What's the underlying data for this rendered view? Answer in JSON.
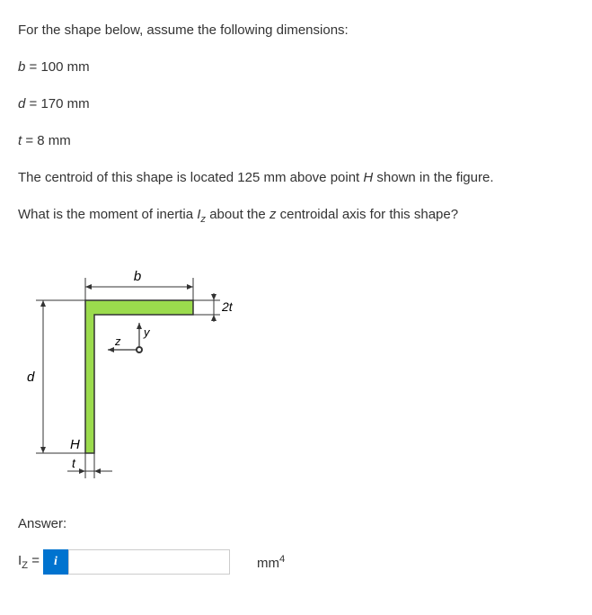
{
  "problem": {
    "intro": "For the shape below, assume the following dimensions:",
    "b_line": "b = 100 mm",
    "d_line": "d = 170 mm",
    "t_line": "t = 8 mm",
    "centroid_statement": "The centroid of this shape is located 125 mm above point H shown in the figure.",
    "question": "What is the moment of inertia Iz about the z centroidal axis for this shape?"
  },
  "figure": {
    "label_b": "b",
    "label_d": "d",
    "label_t": "t",
    "label_2t": "2t",
    "label_H": "H",
    "label_z": "z",
    "label_y": "y"
  },
  "answer": {
    "section_label": "Answer:",
    "iz_prefix": "Iz =",
    "info_symbol": "i",
    "input_value": "",
    "unit": "mm4"
  },
  "chart_data": {
    "type": "diagram",
    "description": "L-shaped cross-section (angle section)",
    "dimensions": {
      "b": 100,
      "d": 170,
      "t": 8,
      "top_flange_thickness": "2t",
      "vertical_leg_thickness": "t"
    },
    "units": "mm",
    "centroid_location_from_H": 125,
    "point_H": "bottom-left outer corner of vertical leg",
    "axes": {
      "z": "horizontal centroidal axis",
      "y": "vertical axis at centroid"
    }
  }
}
